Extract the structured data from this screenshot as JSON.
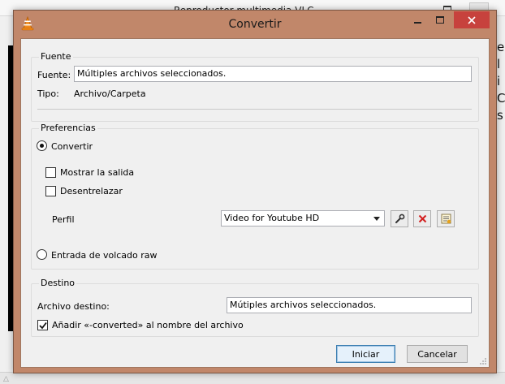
{
  "background_window": {
    "title": "Reproductor multimedia VLC",
    "right_text": [
      "e",
      "l",
      "i",
      "C",
      "s"
    ]
  },
  "dialog": {
    "title": "Convertir",
    "icon": "vlc-cone-icon",
    "controls": {
      "minimize": "minimize-icon",
      "maximize": "maximize-icon",
      "close": "close-icon"
    }
  },
  "fuente": {
    "group_label": "Fuente",
    "source_label": "Fuente:",
    "source_value": "Múltiples archivos seleccionados.",
    "type_label": "Tipo:",
    "type_value": "Archivo/Carpeta"
  },
  "preferencias": {
    "group_label": "Preferencias",
    "convert_radio": {
      "label": "Convertir",
      "checked": true
    },
    "show_output": {
      "label": "Mostrar la salida",
      "checked": false
    },
    "deinterlace": {
      "label": "Desentrelazar",
      "checked": false
    },
    "profile_label": "Perfil",
    "profile_selected": "Video for Youtube HD",
    "profile_buttons": [
      "edit-profile-wrench-icon",
      "delete-profile-icon",
      "new-profile-icon"
    ],
    "raw_dump_radio": {
      "label": "Entrada de volcado raw",
      "checked": false
    }
  },
  "destino": {
    "group_label": "Destino",
    "dest_label": "Archivo destino:",
    "dest_value": "Mútiples archivos seleccionados.",
    "append_converted": {
      "label": "Añadir «-converted» al nombre del archivo",
      "checked": true
    }
  },
  "buttons": {
    "start": "Iniciar",
    "cancel": "Cancelar"
  },
  "colors": {
    "frame": "#c1876a",
    "close_button": "#c7423d",
    "default_button_border": "#3c7fb1"
  }
}
